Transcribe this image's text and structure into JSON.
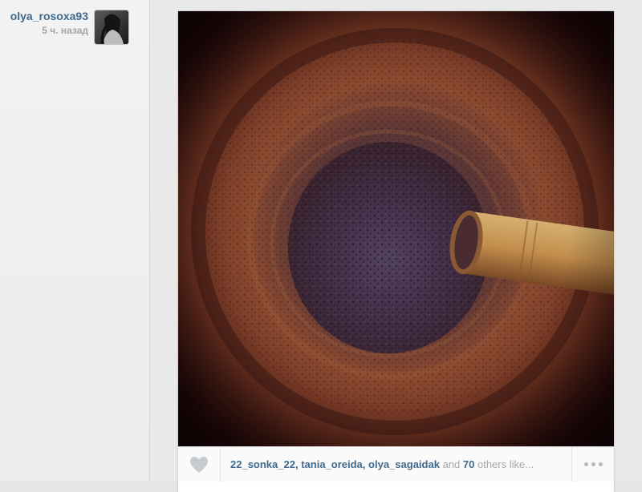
{
  "post": {
    "username": "olya_rosoxa93",
    "time_ago": "5 ч. назад",
    "avatar_icon": "user-avatar-photo"
  },
  "likes": {
    "likers": [
      "22_sonka_22",
      "tania_oreida",
      "olya_sagaidak"
    ],
    "separator_comma": ",",
    "and_text": "and",
    "others_count": "70",
    "others_text": "others like..."
  },
  "colors": {
    "link_blue": "#3f6a8d",
    "muted_gray": "#9ea5ab"
  }
}
